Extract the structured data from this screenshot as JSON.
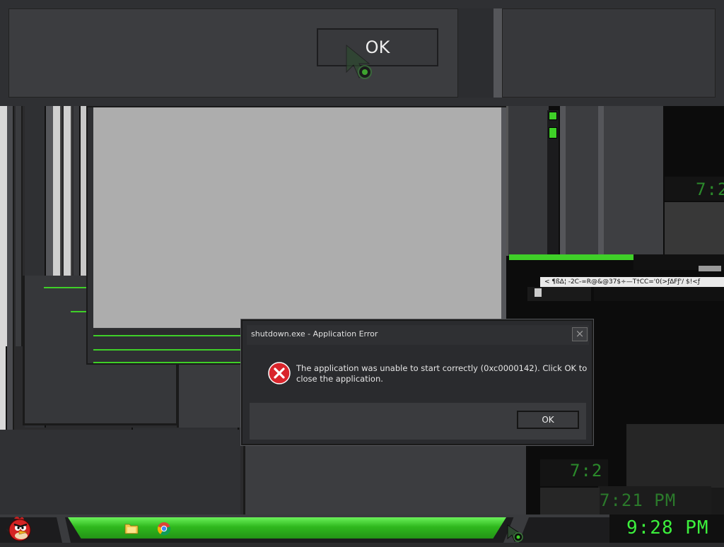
{
  "ghost_dialog": {
    "ok_label": "OK"
  },
  "error_dialog": {
    "title": "shutdown.exe - Application Error",
    "message_line1": "The application was unable to start correctly (0xc0000142). Click OK to",
    "message_line2": "close the application.",
    "ok_label": "OK",
    "close_glyph": "×"
  },
  "glitch": {
    "garbled_text": "< ¶ß∆¦ -2C-∞R@&@37$÷—T†CC='0(>ƒ∆Fƒ'/ $!<ƒ",
    "clock_ghost_1": "7:2",
    "clock_ghost_2": "7:2",
    "clock_ghost_3": "7:21 PM"
  },
  "taskbar": {
    "clock": "9:28 PM"
  },
  "icons": {
    "start": "angry-bird-start-icon",
    "explorer": "folder-icon",
    "browser": "chrome-icon",
    "error": "error-icon",
    "cursor": "cursor-icon"
  },
  "colors": {
    "accent_green": "#3fd028",
    "clock_green": "#3cf03c",
    "error_red": "#d9252c"
  }
}
